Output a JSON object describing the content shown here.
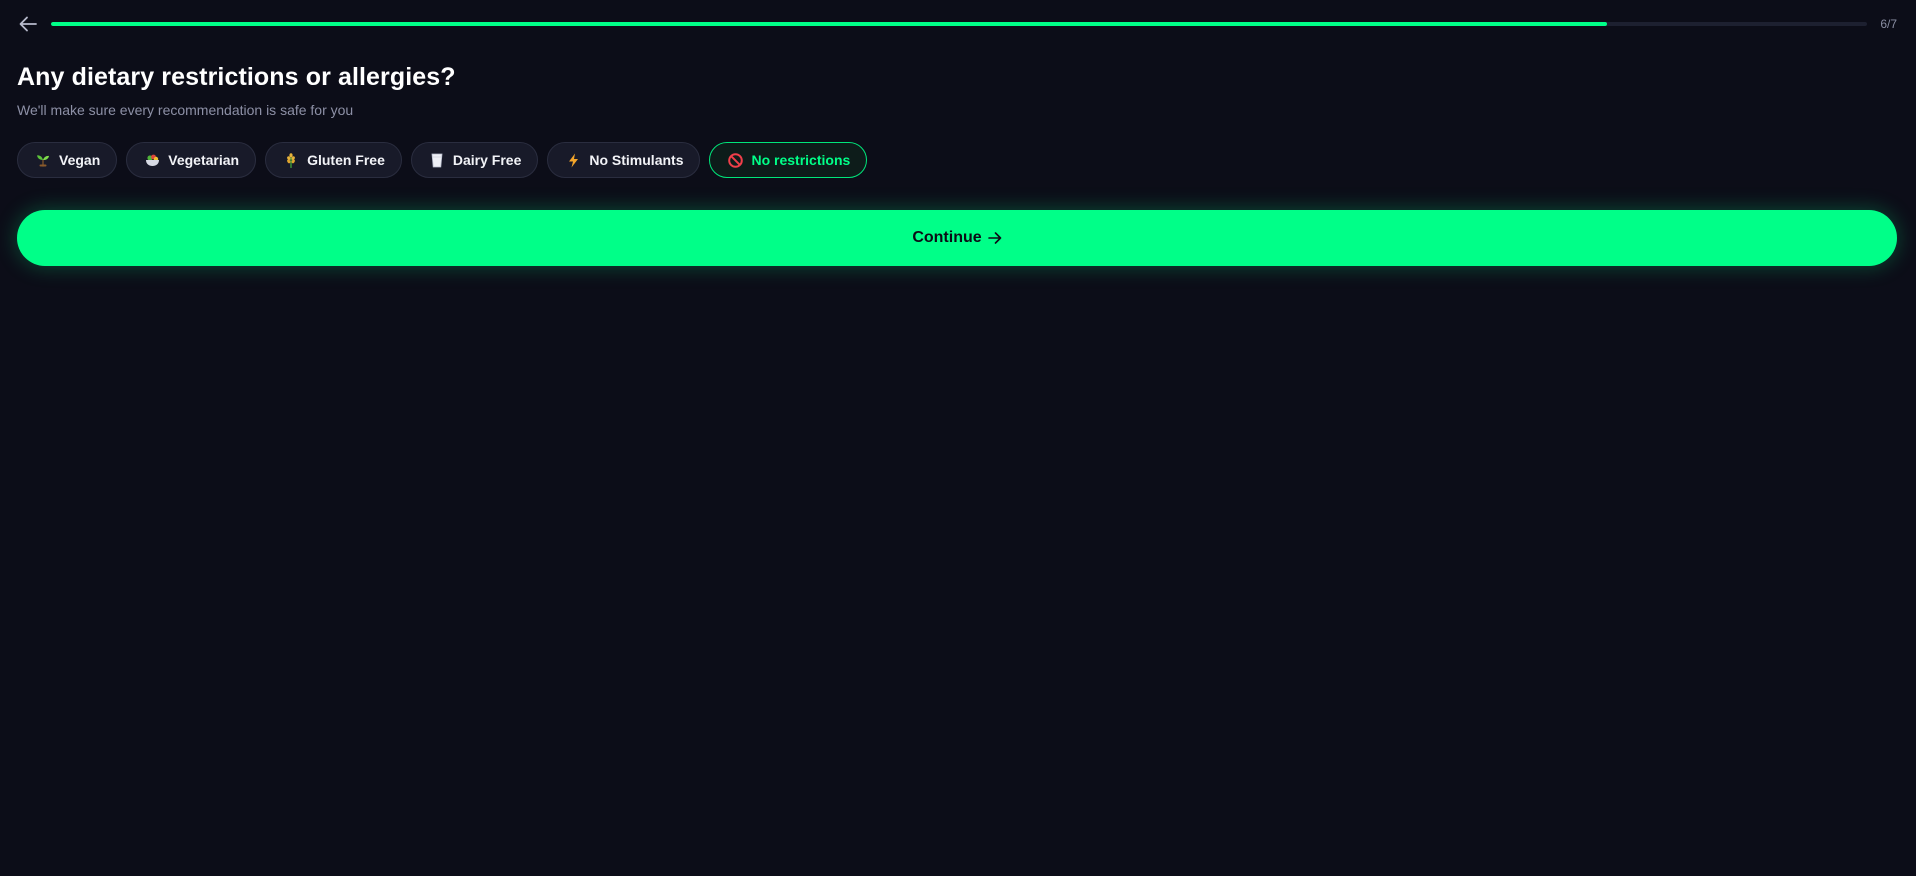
{
  "header": {
    "back_icon": "arrow-left-icon",
    "progress": 6,
    "progress_total": 7,
    "progress_fraction": 0.857,
    "step_label": "6/7",
    "accent_color": "#00ff88"
  },
  "question": {
    "title": "Any dietary restrictions or allergies?",
    "subtitle": "We'll make sure every recommendation is safe for you"
  },
  "options": [
    {
      "label": "Vegan",
      "icon": "seedling-icon",
      "selected": false
    },
    {
      "label": "Vegetarian",
      "icon": "salad-bowl-icon",
      "selected": false
    },
    {
      "label": "Gluten Free",
      "icon": "wheat-icon",
      "selected": false
    },
    {
      "label": "Dairy Free",
      "icon": "milk-glass-icon",
      "selected": false
    },
    {
      "label": "No Stimulants",
      "icon": "lightning-icon",
      "selected": false
    },
    {
      "label": "No restrictions",
      "icon": "prohibited-icon",
      "selected": true
    }
  ],
  "footer": {
    "continue_label": "Continue",
    "continue_icon": "arrow-right-icon"
  }
}
